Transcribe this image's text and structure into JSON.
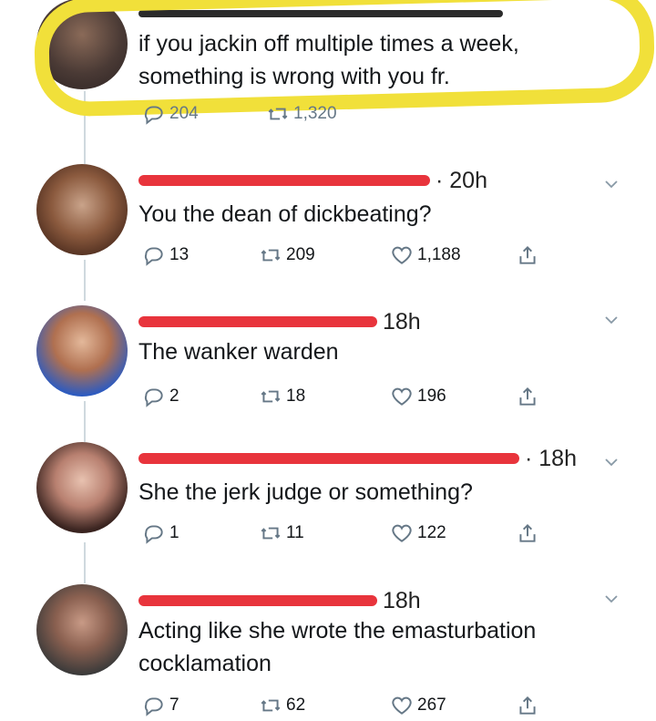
{
  "tweets": [
    {
      "text": "if you jackin off multiple times a week,\nsomething is wrong with you fr.",
      "reply_count": "204",
      "retweet_count": "1,320"
    },
    {
      "time": "· 20h",
      "text": "You the dean of dickbeating?",
      "reply_count": "13",
      "retweet_count": "209",
      "like_count": "1,188"
    },
    {
      "time": "18h",
      "text": "The wanker warden",
      "reply_count": "2",
      "retweet_count": "18",
      "like_count": "196"
    },
    {
      "time": "· 18h",
      "text": "She the jerk judge or something?",
      "reply_count": "1",
      "retweet_count": "11",
      "like_count": "122"
    },
    {
      "time": "18h",
      "text": "Acting like she wrote the emasturbation\ncocklamation",
      "reply_count": "7",
      "retweet_count": "62",
      "like_count": "267"
    }
  ],
  "colors": {
    "highlight": "#f1e03a",
    "redaction": "#e8343c",
    "icon_gray": "#657786"
  }
}
